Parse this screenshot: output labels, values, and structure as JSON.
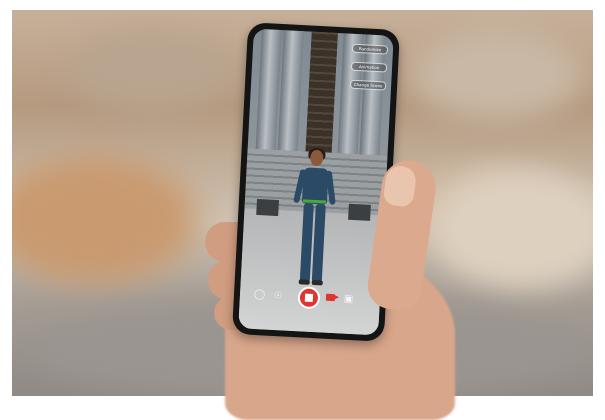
{
  "scene": {
    "description_hidden": "",
    "overlay_buttons": [
      {
        "label": "Randomize"
      },
      {
        "label": "Animation"
      },
      {
        "label": "Change Scene"
      }
    ],
    "controls": {
      "left_icon": "chat-bubble-icon",
      "mic_icon": "microphone-icon",
      "record_icon": "stop-record-icon",
      "video_icon": "video-camera-icon",
      "camera_icon": "camera-icon"
    },
    "colors": {
      "record": "#e23333",
      "outfit": "#2b4a66",
      "belt": "#4aa83a"
    }
  }
}
